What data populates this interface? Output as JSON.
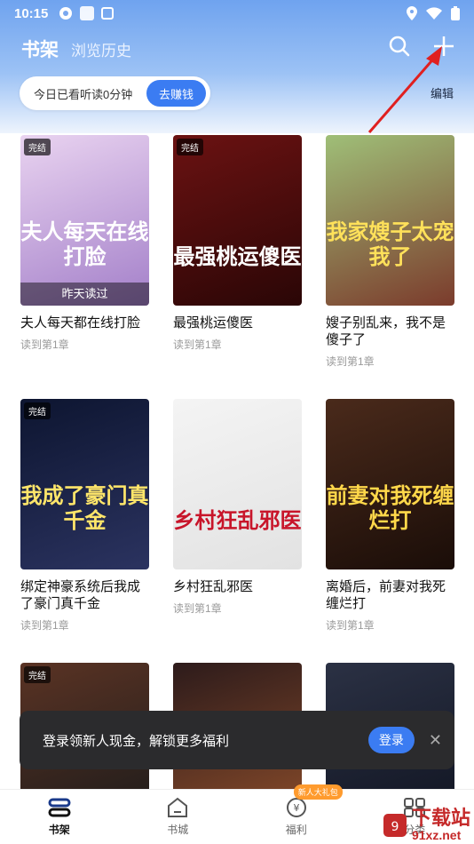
{
  "status": {
    "time": "10:15"
  },
  "header": {
    "tab_active": "书架",
    "tab_history": "浏览历史",
    "edit": "编辑",
    "read_text": "今日已看听读0分钟",
    "earn_button": "去赚钱"
  },
  "books": [
    {
      "title": "夫人每天都在线打脸",
      "progress": "读到第1章",
      "badge": "完结",
      "cover_text": "夫人每天在线打脸",
      "cover_bottom": "昨天读过",
      "colors": [
        "#e9d3f0",
        "#a37fc9"
      ],
      "text_color": "#fff"
    },
    {
      "title": "最强桃运傻医",
      "progress": "读到第1章",
      "badge": "完结",
      "cover_text": "最强桃运傻医",
      "cover_bottom": "",
      "colors": [
        "#6b1212",
        "#2a0606"
      ],
      "text_color": "#fff"
    },
    {
      "title": "嫂子别乱来，我不是傻子了",
      "progress": "读到第1章",
      "badge": "",
      "cover_text": "我家嫂子太宠我了",
      "cover_bottom": "",
      "colors": [
        "#9fbf78",
        "#7b3b2c"
      ],
      "text_color": "#ffe15a"
    },
    {
      "title": "绑定神豪系统后我成了豪门真千金",
      "progress": "读到第1章",
      "badge": "完结",
      "cover_text": "我成了豪门真千金",
      "cover_bottom": "",
      "colors": [
        "#0d1530",
        "#2b3360"
      ],
      "text_color": "#ffe66a"
    },
    {
      "title": "乡村狂乱邪医",
      "progress": "读到第1章",
      "badge": "",
      "cover_text": "乡村狂乱邪医",
      "cover_bottom": "",
      "colors": [
        "#f4f4f4",
        "#e2e2e2"
      ],
      "text_color": "#c8152a"
    },
    {
      "title": "离婚后，前妻对我死缠烂打",
      "progress": "读到第1章",
      "badge": "",
      "cover_text": "前妻对我死缠烂打",
      "cover_bottom": "",
      "colors": [
        "#4a2a1b",
        "#1a0d08"
      ],
      "text_color": "#ffd84a"
    },
    {
      "title": "",
      "progress": "",
      "badge": "完结",
      "cover_text": "",
      "cover_bottom": "",
      "colors": [
        "#5a3324",
        "#1a1a1a"
      ],
      "text_color": "#fff"
    },
    {
      "title": "",
      "progress": "",
      "badge": "",
      "cover_text": "",
      "cover_bottom": "",
      "colors": [
        "#2d1b1b",
        "#8e4e2b"
      ],
      "text_color": "#fff"
    },
    {
      "title": "",
      "progress": "",
      "badge": "",
      "cover_text": "",
      "cover_bottom": "",
      "colors": [
        "#2b3144",
        "#0f1320"
      ],
      "text_color": "#fff"
    }
  ],
  "toast": {
    "text": "登录领新人现金，解锁更多福利",
    "login": "登录"
  },
  "bottom_nav": [
    {
      "label": "书架",
      "icon": "bookshelf-icon",
      "active": true
    },
    {
      "label": "书城",
      "icon": "store-icon",
      "active": false
    },
    {
      "label": "福利",
      "icon": "welfare-icon",
      "active": false,
      "badge": "新人大礼包"
    },
    {
      "label": "分类",
      "icon": "category-icon",
      "active": false
    }
  ],
  "watermark": {
    "main": "下载站",
    "sub": "91xz.net"
  }
}
